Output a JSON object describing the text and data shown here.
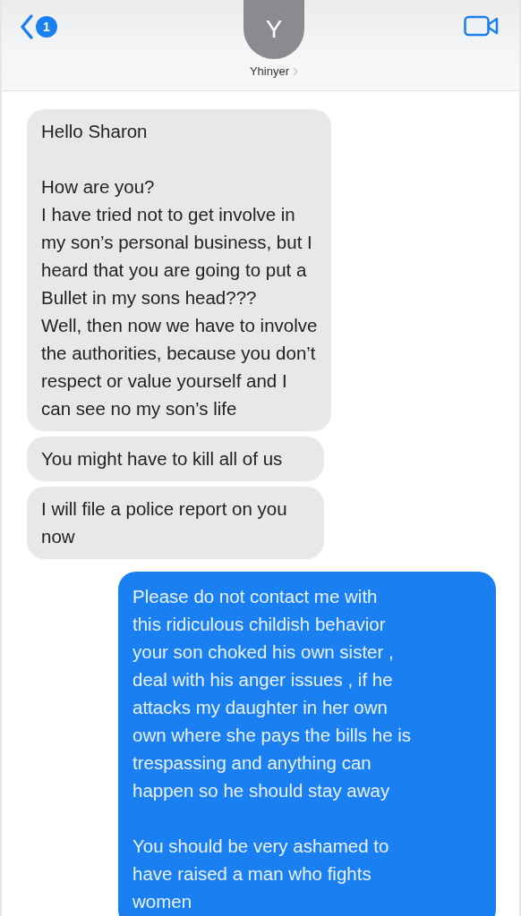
{
  "header": {
    "back_badge": "1",
    "avatar_initial": "Y",
    "contact_name": "Yhinyer"
  },
  "messages": [
    {
      "kind": "received",
      "text": "Hello Sharon\n\nHow are you?\nI have tried not to get involve in\nmy son’s personal business, but I\nheard that you are going to put a\nBullet in my sons head???\nWell, then now we have to involve\nthe authorities, because you don’t\nrespect or value yourself and I\ncan see no my son’s life"
    },
    {
      "kind": "received",
      "text": "You might have to kill all of us"
    },
    {
      "kind": "received",
      "text": "I will file a police report on you\nnow"
    },
    {
      "kind": "sent",
      "text": "Please do not contact me with\nthis ridiculous childish behavior\nyour son choked his own sister ,\ndeal with his anger issues , if he\nattacks my daughter in her own\nown where she pays the bills he is\ntrespassing and anything can\nhappen so he should stay away\n\nYou should be very ashamed to\nhave raised a man who fights\nwomen"
    }
  ]
}
